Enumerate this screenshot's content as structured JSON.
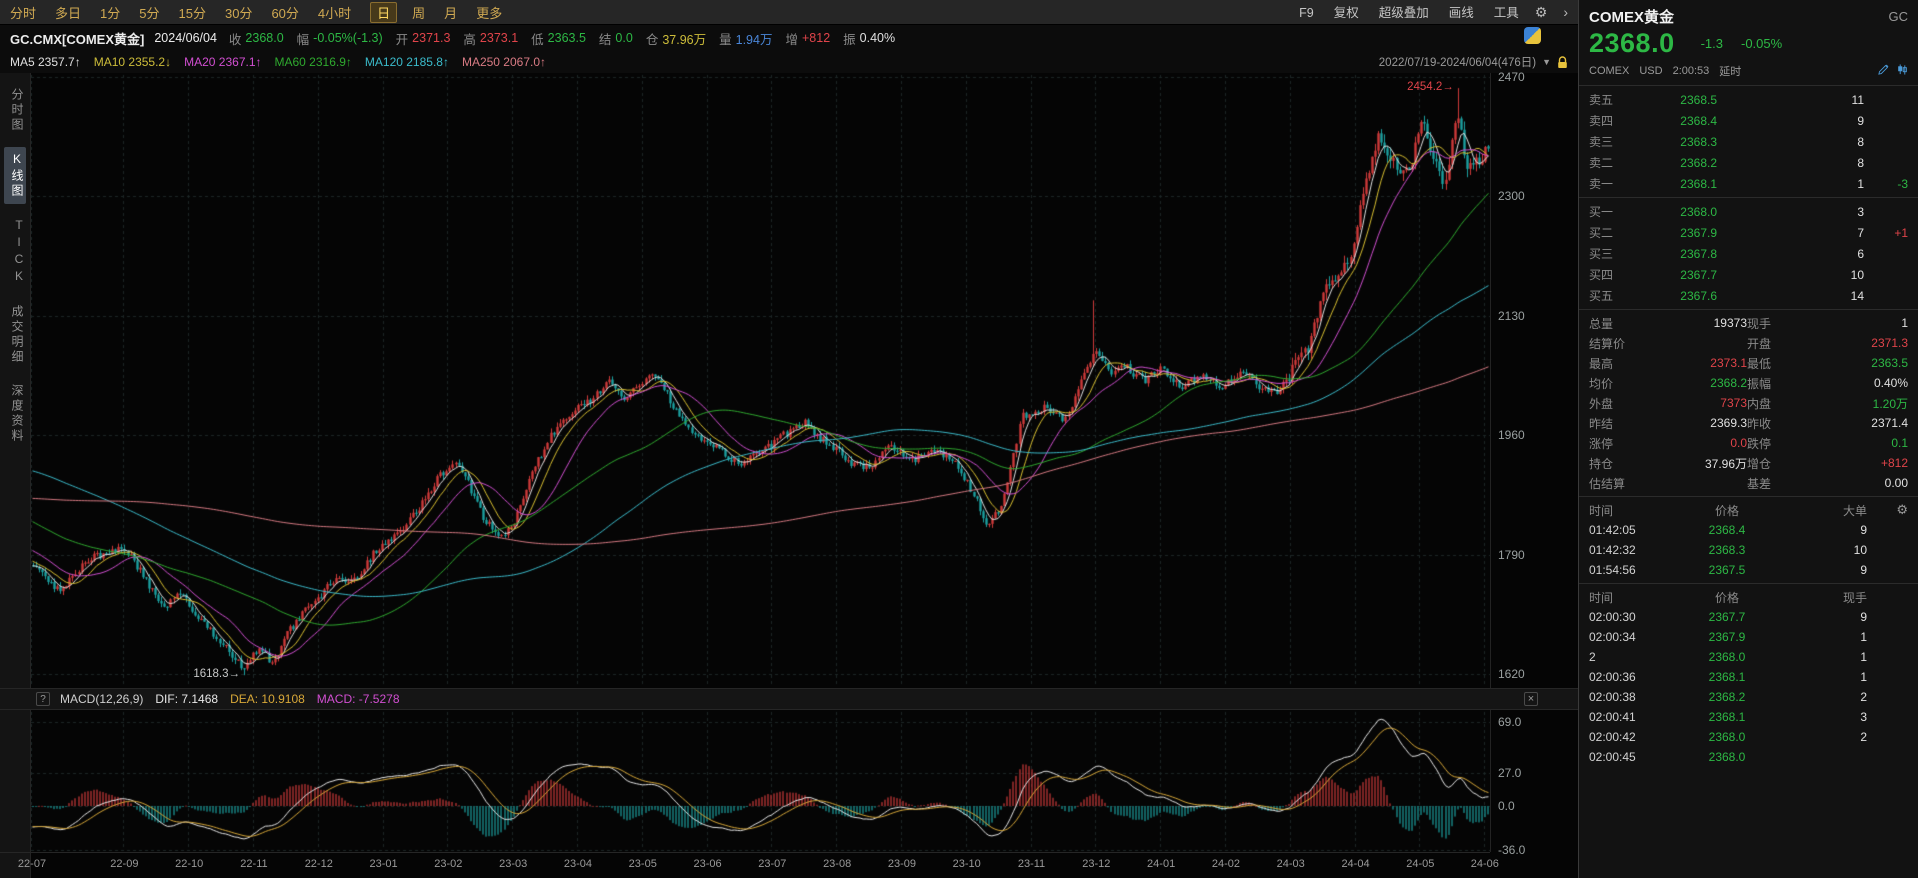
{
  "toolbar": {
    "timeframes": [
      {
        "label": "分时",
        "name": "intraday"
      },
      {
        "label": "多日",
        "name": "multi-day"
      },
      {
        "label": "1分",
        "name": "1min"
      },
      {
        "label": "5分",
        "name": "5min"
      },
      {
        "label": "15分",
        "name": "15min"
      },
      {
        "label": "30分",
        "name": "30min"
      },
      {
        "label": "60分",
        "name": "60min"
      },
      {
        "label": "4小时",
        "name": "4hour"
      },
      {
        "label": "日",
        "name": "daily"
      },
      {
        "label": "周",
        "name": "weekly"
      },
      {
        "label": "月",
        "name": "monthly"
      },
      {
        "label": "更多",
        "name": "more"
      }
    ],
    "active_timeframe": "日",
    "right_items": [
      {
        "label": "F9",
        "name": "f9"
      },
      {
        "label": "复权",
        "name": "adjust"
      },
      {
        "label": "超级叠加",
        "name": "super-overlay"
      },
      {
        "label": "画线",
        "name": "draw-line"
      },
      {
        "label": "工具",
        "name": "tools"
      }
    ],
    "gear_icon": "⚙",
    "chevron": "›"
  },
  "quote_bar": {
    "symbol": "GC.CMX[COMEX黄金]",
    "date": "2024/06/04",
    "fields": [
      {
        "label": "收",
        "value": "2368.0",
        "tone": "green",
        "name": "close"
      },
      {
        "label": "幅",
        "value": "-0.05%(-1.3)",
        "tone": "green",
        "name": "change"
      },
      {
        "label": "开",
        "value": "2371.3",
        "tone": "red",
        "name": "open"
      },
      {
        "label": "高",
        "value": "2373.1",
        "tone": "red",
        "name": "high"
      },
      {
        "label": "低",
        "value": "2363.5",
        "tone": "green",
        "name": "low"
      },
      {
        "label": "结",
        "value": "0.0",
        "tone": "green",
        "name": "settlement"
      },
      {
        "label": "仓",
        "value": "37.96万",
        "tone": "yellow",
        "name": "open-interest"
      },
      {
        "label": "量",
        "value": "1.94万",
        "tone": "blue",
        "name": "volume"
      },
      {
        "label": "增",
        "value": "+812",
        "tone": "red",
        "name": "oi-change"
      },
      {
        "label": "振",
        "value": "0.40%",
        "tone": "white",
        "name": "amplitude"
      }
    ]
  },
  "ma_bar": {
    "items": [
      {
        "label": "MA5",
        "value": "2357.7",
        "dir": "↑",
        "tone": "white"
      },
      {
        "label": "MA10",
        "value": "2355.2",
        "dir": "↓",
        "tone": "yellow"
      },
      {
        "label": "MA20",
        "value": "2367.1",
        "dir": "↑",
        "tone": "magenta"
      },
      {
        "label": "MA60",
        "value": "2316.9",
        "dir": "↑",
        "tone": "green2"
      },
      {
        "label": "MA120",
        "value": "2185.8",
        "dir": "↑",
        "tone": "cyan"
      },
      {
        "label": "MA250",
        "value": "2067.0",
        "dir": "↑",
        "tone": "salmon"
      }
    ],
    "range": "2022/07/19-2024/06/04(476日)",
    "dropdown": "▼"
  },
  "sidebar": {
    "items": [
      {
        "label": "分时图",
        "name": "time-chart",
        "active": false
      },
      {
        "label": "K线图",
        "name": "kline-chart",
        "active": true
      },
      {
        "label": "TICK",
        "name": "tick",
        "active": false
      },
      {
        "label": "成交明细",
        "name": "trade-detail",
        "active": false
      },
      {
        "label": "深度资料",
        "name": "depth-data",
        "active": false
      }
    ]
  },
  "macd": {
    "help": "?",
    "title": "MACD(12,26,9)",
    "dif_label": "DIF: 7.1468",
    "dea_label": "DEA: 10.9108",
    "macd_label": "MACD: -7.5278",
    "close": "×"
  },
  "chart_data": {
    "type": "candlestick",
    "title": "GC.CMX COMEX黄金 日K线 2022/07/19-2024/06/04 (476根K线)",
    "visible_bars": 476,
    "history_bars": 280,
    "price_axis": [
      2470,
      2300,
      2130,
      1960,
      1790,
      1620
    ],
    "macd_axis": [
      {
        "label": "69.0",
        "v": 69
      },
      {
        "label": "27.0",
        "v": 27
      },
      {
        "label": "0.0",
        "v": 0
      },
      {
        "label": "-36.0",
        "v": -36
      }
    ],
    "months": [
      {
        "label": "22-07",
        "m": 0
      },
      {
        "label": "22-09",
        "m": 2
      },
      {
        "label": "22-10",
        "m": 3
      },
      {
        "label": "22-11",
        "m": 4
      },
      {
        "label": "22-12",
        "m": 5
      },
      {
        "label": "23-01",
        "m": 6
      },
      {
        "label": "23-02",
        "m": 7
      },
      {
        "label": "23-03",
        "m": 8
      },
      {
        "label": "23-04",
        "m": 9
      },
      {
        "label": "23-05",
        "m": 10
      },
      {
        "label": "23-06",
        "m": 11
      },
      {
        "label": "23-07",
        "m": 12
      },
      {
        "label": "23-08",
        "m": 13
      },
      {
        "label": "23-09",
        "m": 14
      },
      {
        "label": "23-10",
        "m": 15
      },
      {
        "label": "23-11",
        "m": 16
      },
      {
        "label": "23-12",
        "m": 17
      },
      {
        "label": "24-01",
        "m": 18
      },
      {
        "label": "24-02",
        "m": 19
      },
      {
        "label": "24-03",
        "m": 20
      },
      {
        "label": "24-04",
        "m": 21
      },
      {
        "label": "24-05",
        "m": 22
      },
      {
        "label": "24-06",
        "m": 23
      }
    ],
    "anchors": [
      [
        -0.59,
        1895
      ],
      [
        -0.5,
        1795
      ],
      [
        -0.37,
        1860
      ],
      [
        -0.32,
        1795
      ],
      [
        -0.19,
        2040
      ],
      [
        -0.145,
        1960
      ],
      [
        -0.1,
        1855
      ],
      [
        -0.057,
        1845
      ],
      [
        0,
        1768
      ],
      [
        0.02,
        1742
      ],
      [
        0.04,
        1786
      ],
      [
        0.06,
        1800
      ],
      [
        0.075,
        1765
      ],
      [
        0.09,
        1712
      ],
      [
        0.1,
        1736
      ],
      [
        0.115,
        1700
      ],
      [
        0.13,
        1662
      ],
      [
        0.145,
        1632
      ],
      [
        0.155,
        1650
      ],
      [
        0.165,
        1636
      ],
      [
        0.175,
        1682
      ],
      [
        0.19,
        1712
      ],
      [
        0.205,
        1756
      ],
      [
        0.22,
        1750
      ],
      [
        0.235,
        1798
      ],
      [
        0.25,
        1812
      ],
      [
        0.265,
        1858
      ],
      [
        0.28,
        1900
      ],
      [
        0.29,
        1926
      ],
      [
        0.3,
        1888
      ],
      [
        0.31,
        1840
      ],
      [
        0.32,
        1814
      ],
      [
        0.33,
        1838
      ],
      [
        0.345,
        1910
      ],
      [
        0.355,
        1962
      ],
      [
        0.37,
        1988
      ],
      [
        0.385,
        2012
      ],
      [
        0.395,
        2042
      ],
      [
        0.405,
        2008
      ],
      [
        0.415,
        2028
      ],
      [
        0.425,
        2052
      ],
      [
        0.435,
        2018
      ],
      [
        0.445,
        1984
      ],
      [
        0.455,
        1960
      ],
      [
        0.47,
        1940
      ],
      [
        0.485,
        1922
      ],
      [
        0.5,
        1936
      ],
      [
        0.515,
        1960
      ],
      [
        0.53,
        1976
      ],
      [
        0.545,
        1952
      ],
      [
        0.56,
        1920
      ],
      [
        0.575,
        1916
      ],
      [
        0.59,
        1944
      ],
      [
        0.605,
        1928
      ],
      [
        0.62,
        1940
      ],
      [
        0.635,
        1922
      ],
      [
        0.645,
        1878
      ],
      [
        0.655,
        1832
      ],
      [
        0.665,
        1862
      ],
      [
        0.68,
        1986
      ],
      [
        0.695,
        2002
      ],
      [
        0.71,
        1978
      ],
      [
        0.72,
        2038
      ],
      [
        0.73,
        2088
      ],
      [
        0.74,
        2046
      ],
      [
        0.75,
        2060
      ],
      [
        0.765,
        2036
      ],
      [
        0.775,
        2054
      ],
      [
        0.79,
        2032
      ],
      [
        0.805,
        2044
      ],
      [
        0.815,
        2030
      ],
      [
        0.83,
        2046
      ],
      [
        0.84,
        2034
      ],
      [
        0.855,
        2018
      ],
      [
        0.865,
        2046
      ],
      [
        0.875,
        2084
      ],
      [
        0.885,
        2160
      ],
      [
        0.895,
        2178
      ],
      [
        0.905,
        2212
      ],
      [
        0.915,
        2320
      ],
      [
        0.925,
        2388
      ],
      [
        0.935,
        2346
      ],
      [
        0.945,
        2332
      ],
      [
        0.955,
        2408
      ],
      [
        0.962,
        2352
      ],
      [
        0.97,
        2312
      ],
      [
        0.978,
        2420
      ],
      [
        0.986,
        2336
      ],
      [
        0.993,
        2352
      ],
      [
        1,
        2368
      ]
    ],
    "specials": {
      "low_t": 0.145,
      "low": 1618.3,
      "high_t": 0.978,
      "high": 2454.2,
      "spike_t": 0.728,
      "spike": 2152
    },
    "last": {
      "open": 2371.3,
      "high": 2373.1,
      "low": 2363.5,
      "close": 2368.0
    },
    "ma": [
      {
        "period": 5,
        "color": "ma5"
      },
      {
        "period": 10,
        "color": "ma10"
      },
      {
        "period": 20,
        "color": "ma20"
      },
      {
        "period": 60,
        "color": "ma60"
      },
      {
        "period": 120,
        "color": "ma120"
      },
      {
        "period": 250,
        "color": "ma250"
      }
    ],
    "macd_params": {
      "fast": 12,
      "slow": 26,
      "signal": 9,
      "dif": 7.1468,
      "dea": 10.9108,
      "macd": -7.5278
    },
    "annotations": [
      {
        "text": "2454.2",
        "t": 0.978,
        "price": 2454.2,
        "tone": "red"
      },
      {
        "text": "1618.3",
        "t": 0.145,
        "price": 1618.3,
        "tone": "white"
      }
    ]
  },
  "panel": {
    "title": "COMEX黄金",
    "code": "GC",
    "price": "2368.0",
    "change": "-1.3",
    "change_pct": "-0.05%",
    "exchange": "COMEX",
    "currency": "USD",
    "time": "2:00:53",
    "delay": "延时",
    "gear_icon": "⚙",
    "asks": [
      {
        "name": "ask-5",
        "l": "卖五",
        "p": "2368.5",
        "v": "11",
        "d": "",
        "dt": ""
      },
      {
        "name": "ask-4",
        "l": "卖四",
        "p": "2368.4",
        "v": "9",
        "d": "",
        "dt": ""
      },
      {
        "name": "ask-3",
        "l": "卖三",
        "p": "2368.3",
        "v": "8",
        "d": "",
        "dt": ""
      },
      {
        "name": "ask-2",
        "l": "卖二",
        "p": "2368.2",
        "v": "8",
        "d": "",
        "dt": ""
      },
      {
        "name": "ask-1",
        "l": "卖一",
        "p": "2368.1",
        "v": "1",
        "d": "-3",
        "dt": "green"
      }
    ],
    "bids": [
      {
        "name": "bid-1",
        "l": "买一",
        "p": "2368.0",
        "v": "3",
        "d": "",
        "dt": ""
      },
      {
        "name": "bid-2",
        "l": "买二",
        "p": "2367.9",
        "v": "7",
        "d": "+1",
        "dt": "red"
      },
      {
        "name": "bid-3",
        "l": "买三",
        "p": "2367.8",
        "v": "6",
        "d": "",
        "dt": ""
      },
      {
        "name": "bid-4",
        "l": "买四",
        "p": "2367.7",
        "v": "10",
        "d": "",
        "dt": ""
      },
      {
        "name": "bid-5",
        "l": "买五",
        "p": "2367.6",
        "v": "14",
        "d": "",
        "dt": ""
      }
    ],
    "stats": [
      [
        {
          "l": "总量",
          "v": "19373",
          "t": "white"
        },
        {
          "l": "现手",
          "v": "1",
          "t": "white"
        }
      ],
      [
        {
          "l": "结算价",
          "v": "",
          "t": "white"
        },
        {
          "l": "开盘",
          "v": "2371.3",
          "t": "red"
        }
      ],
      [
        {
          "l": "最高",
          "v": "2373.1",
          "t": "red"
        },
        {
          "l": "最低",
          "v": "2363.5",
          "t": "green"
        }
      ],
      [
        {
          "l": "均价",
          "v": "2368.2",
          "t": "green"
        },
        {
          "l": "振幅",
          "v": "0.40%",
          "t": "white"
        }
      ],
      [
        {
          "l": "外盘",
          "v": "7373",
          "t": "red"
        },
        {
          "l": "内盘",
          "v": "1.20万",
          "t": "green"
        }
      ],
      [
        {
          "l": "昨结",
          "v": "2369.3",
          "t": "white"
        },
        {
          "l": "昨收",
          "v": "2371.4",
          "t": "white"
        }
      ],
      [
        {
          "l": "涨停",
          "v": "0.0",
          "t": "red"
        },
        {
          "l": "跌停",
          "v": "0.1",
          "t": "green"
        }
      ],
      [
        {
          "l": "持仓",
          "v": "37.96万",
          "t": "white"
        },
        {
          "l": "增仓",
          "v": "+812",
          "t": "red"
        }
      ],
      [
        {
          "l": "估结算",
          "v": "",
          "t": "white"
        },
        {
          "l": "基差",
          "v": "0.00",
          "t": "white"
        }
      ]
    ],
    "deals_large": {
      "headers": [
        "时间",
        "价格",
        "大单"
      ],
      "rows": [
        [
          "01:42:05",
          "2368.4",
          "9"
        ],
        [
          "01:42:32",
          "2368.3",
          "10"
        ],
        [
          "01:54:56",
          "2367.5",
          "9"
        ]
      ]
    },
    "deals": {
      "headers": [
        "时间",
        "价格",
        "现手"
      ],
      "rows": [
        [
          "02:00:30",
          "2367.7",
          "9"
        ],
        [
          "02:00:34",
          "2367.9",
          "1"
        ],
        [
          "2",
          "2368.0",
          "1"
        ],
        [
          "02:00:36",
          "2368.1",
          "1"
        ],
        [
          "02:00:38",
          "2368.2",
          "2"
        ],
        [
          "02:00:41",
          "2368.1",
          "3"
        ],
        [
          "02:00:42",
          "2368.0",
          "2"
        ],
        [
          "02:00:45",
          "2368.0",
          ""
        ]
      ]
    }
  },
  "colors": {
    "candle_up": "#cf3a3a",
    "candle_down": "#1ba0a0",
    "grid": "#1c2525",
    "ma5": "#e2e2e2",
    "ma10": "#d9c030",
    "ma20": "#d24fd2",
    "ma60": "#2faa2f",
    "ma120": "#3bbccc",
    "ma250": "#d97b84",
    "dif": "#e8e8e8",
    "dea": "#d8a838",
    "red": "#e0444a",
    "green": "#2db845",
    "yellow": "#cdbd3a",
    "blue": "#4a86d8"
  }
}
